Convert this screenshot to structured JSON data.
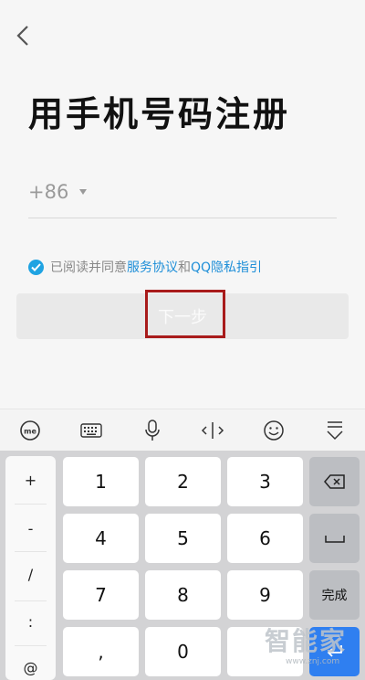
{
  "header": {
    "back_icon": "chevron-left-icon",
    "title": "用手机号码注册"
  },
  "phone": {
    "country_code": "+86",
    "value": "",
    "placeholder": ""
  },
  "agreement": {
    "checked": true,
    "prefix": "已阅读并同意",
    "terms_link": "服务协议",
    "and": "和",
    "privacy_link": "QQ隐私指引"
  },
  "next_button": {
    "label": "下一步"
  },
  "keyboard_toolbar": {
    "icons": [
      "ime-logo-icon",
      "keyboard-icon",
      "microphone-icon",
      "cursor-move-icon",
      "emoji-icon",
      "hide-keyboard-icon"
    ]
  },
  "keyboard": {
    "symbols": [
      "+",
      "-",
      "/",
      ":",
      "@"
    ],
    "digits": [
      "1",
      "2",
      "3",
      "4",
      "5",
      "6",
      "7",
      "8",
      "9",
      ",",
      "0"
    ],
    "done_label": "完成",
    "accent_color": "#2f7ff0"
  },
  "watermark": {
    "text": "智能家",
    "url": "www.znj.com"
  },
  "colors": {
    "link": "#1f8fd8",
    "check": "#1fa3e2",
    "highlight_border": "#a81b1b"
  }
}
